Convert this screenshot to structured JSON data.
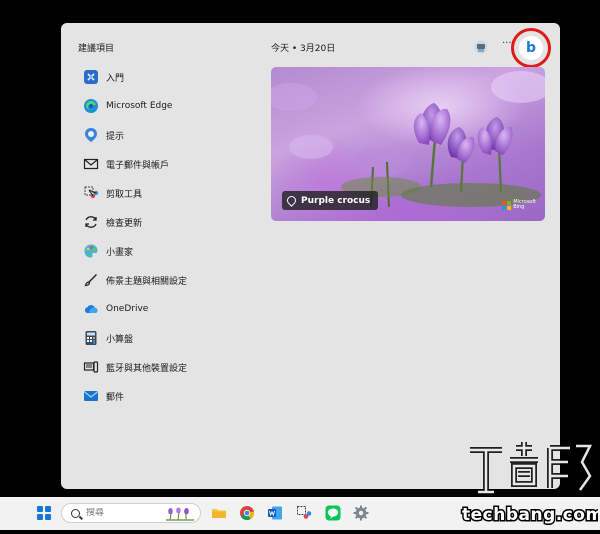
{
  "widgets": {
    "section_title": "建議項目",
    "items": [
      {
        "label": "入門",
        "icon": "get-started-icon"
      },
      {
        "label": "Microsoft Edge",
        "icon": "edge-icon"
      },
      {
        "label": "提示",
        "icon": "tips-icon"
      },
      {
        "label": "電子郵件與帳戶",
        "icon": "mail-icon"
      },
      {
        "label": "剪取工具",
        "icon": "snipping-tool-icon"
      },
      {
        "label": "檢查更新",
        "icon": "refresh-icon"
      },
      {
        "label": "小畫家",
        "icon": "paint-icon"
      },
      {
        "label": "佈景主題與相關設定",
        "icon": "brush-icon"
      },
      {
        "label": "OneDrive",
        "icon": "onedrive-icon"
      },
      {
        "label": "小算盤",
        "icon": "calculator-icon"
      },
      {
        "label": "藍牙與其他裝置設定",
        "icon": "devices-icon"
      },
      {
        "label": "郵件",
        "icon": "mail-app-icon"
      }
    ],
    "date_label": "今天 • 3月20日",
    "more_label": "···",
    "bing_button": "b",
    "photo_card": {
      "caption": "Purple crocus",
      "logo_line1": "Microsoft",
      "logo_line2": "Bing"
    }
  },
  "taskbar": {
    "search_placeholder": "搜尋"
  },
  "watermark": {
    "text": "techbang.com"
  },
  "colors": {
    "panel_bg": "#e4e4e4",
    "highlight_circle": "#e01919",
    "accent_blue": "#1877d4",
    "photo_purple": "#a977cf"
  }
}
